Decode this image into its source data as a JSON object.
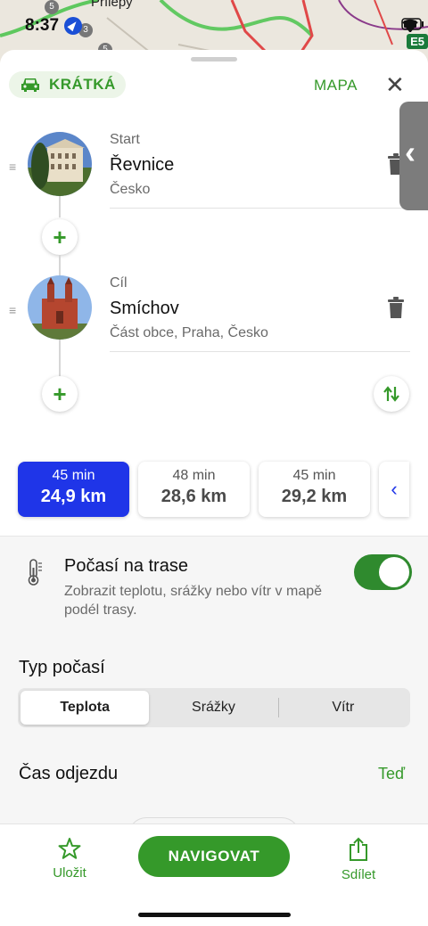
{
  "status": {
    "time": "8:37",
    "map_label": "Přílepy",
    "road_label": "E5",
    "road_numbers": [
      "5",
      "3",
      "5"
    ]
  },
  "header": {
    "mode_label": "KRÁTKÁ",
    "mode_icon": "car-icon",
    "map_link": "MAPA",
    "close_icon": "close-icon"
  },
  "waypoints": [
    {
      "type": "Start",
      "name": "Řevnice",
      "subtitle": "Česko"
    },
    {
      "type": "Cíl",
      "name": "Smíchov",
      "subtitle": "Část obce, Praha, Česko"
    }
  ],
  "routes": [
    {
      "time": "45 min",
      "distance": "24,9 km",
      "selected": true
    },
    {
      "time": "48 min",
      "distance": "28,6 km",
      "selected": false
    },
    {
      "time": "45 min",
      "distance": "29,2 km",
      "selected": false
    }
  ],
  "weather": {
    "title": "Počasí na trase",
    "description": "Zobrazit teplotu, srážky nebo vítr v mapě podél trasy.",
    "enabled": true
  },
  "weather_type": {
    "label": "Typ počasí",
    "options": [
      "Teplota",
      "Srážky",
      "Vítr"
    ],
    "selected": "Teplota"
  },
  "departure": {
    "label": "Čas odjezdu",
    "value": "Teď"
  },
  "bottom": {
    "save_label": "Uložit",
    "navigate_label": "NAVIGOVAT",
    "share_label": "Sdílet"
  },
  "colors": {
    "accent": "#35992a",
    "route_selected": "#1f35e8",
    "toggle_on": "#2f8a2e"
  }
}
